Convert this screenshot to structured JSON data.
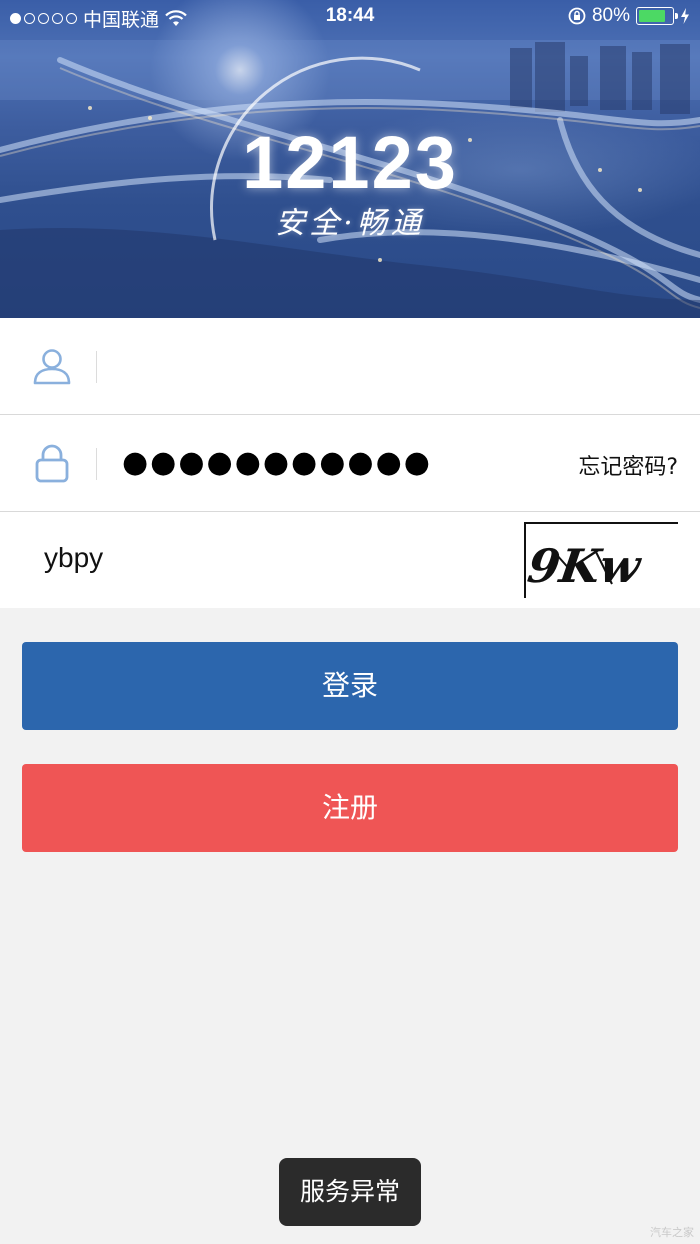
{
  "status_bar": {
    "carrier": "中国联通",
    "time": "18:44",
    "battery_percent": "80%",
    "battery_level": 0.8,
    "signal_bars": 1,
    "signal_total": 5
  },
  "hero": {
    "title": "12123",
    "slogan": "安全·畅通"
  },
  "form": {
    "username": {
      "value": "",
      "icon": "user-icon"
    },
    "password": {
      "masked_value": "●●●●●●●●●●●",
      "icon": "lock-icon",
      "forgot_label": "忘记密码?"
    },
    "captcha": {
      "value": "ybpy",
      "image_text": "9Kw"
    }
  },
  "buttons": {
    "login_label": "登录",
    "register_label": "注册"
  },
  "toast": {
    "message": "服务异常"
  },
  "watermark": "汽车之家",
  "colors": {
    "login": "#2c66ad",
    "register": "#ef5555",
    "icon": "#8ab0dd",
    "battery": "#4cd964",
    "background": "#f2f2f2"
  }
}
